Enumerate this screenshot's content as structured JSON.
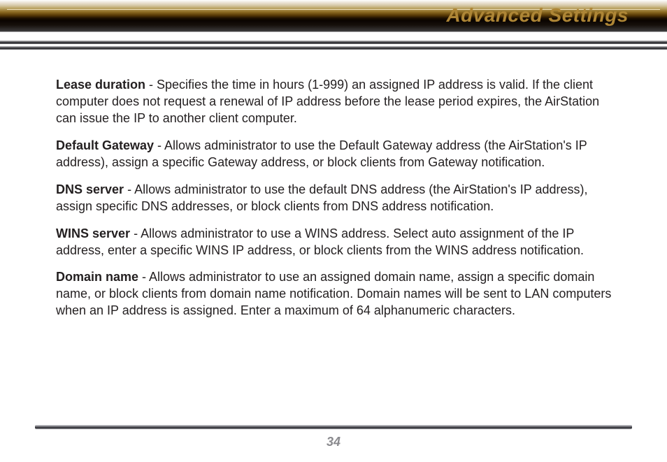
{
  "header": {
    "title": "Advanced Settings"
  },
  "sections": [
    {
      "term": "Lease duration",
      "text": " - Specifies the time in hours (1-999) an assigned IP address is valid. If the client computer does not request a renewal of IP address before the lease period expires, the AirStation can issue the IP to another client computer."
    },
    {
      "term": "Default Gateway ",
      "text": " - Allows administrator to use the Default Gateway address (the AirStation's IP address), assign a specific Gateway address, or block clients from Gateway notification."
    },
    {
      "term": "DNS server",
      "text": " - Allows administrator to use the default DNS address (the AirStation's IP address), assign specific DNS addresses, or block clients from DNS address notification."
    },
    {
      "term": "WINS server",
      "text": " - Allows administrator to use a WINS address.  Select auto assignment of the IP address, enter a specific WINS IP address, or block clients from the WINS address notification."
    },
    {
      "term": "Domain name",
      "text": " - Allows administrator to use an assigned domain name, assign a specific domain name, or block clients from domain name notification.  Domain names will be sent to LAN computers when an IP address is assigned.  Enter a maximum of 64 alphanumeric characters."
    }
  ],
  "footer": {
    "page": "34"
  }
}
